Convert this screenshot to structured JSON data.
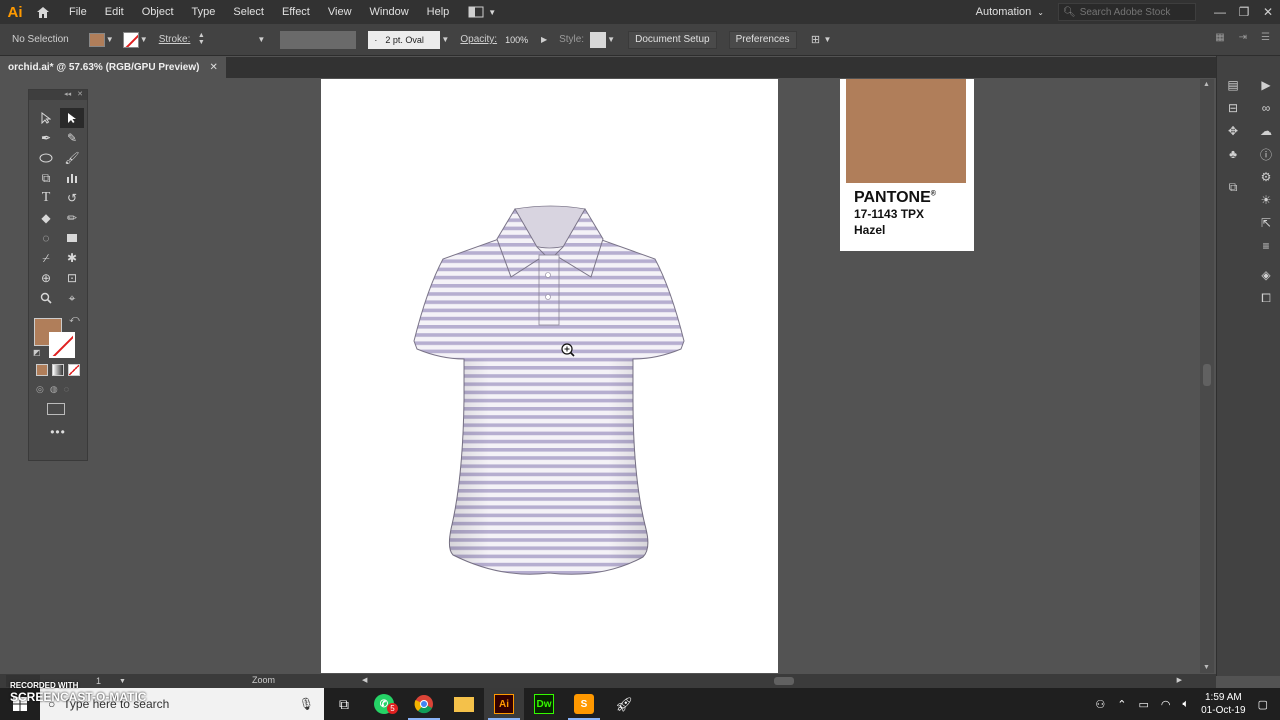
{
  "app": {
    "logo": "Ai"
  },
  "menu": [
    "File",
    "Edit",
    "Object",
    "Type",
    "Select",
    "Effect",
    "View",
    "Window",
    "Help"
  ],
  "workspace": {
    "label": "Automation"
  },
  "stock_search": {
    "placeholder": "Search Adobe Stock"
  },
  "control_bar": {
    "selection": "No Selection",
    "fill_color": "#b07e5a",
    "stroke_label": "Stroke:",
    "brush": "2 pt. Oval",
    "opacity_label": "Opacity:",
    "opacity_value": "100%",
    "style_label": "Style:",
    "document_setup": "Document Setup",
    "preferences": "Preferences"
  },
  "document_tab": {
    "title": "orchid.ai* @ 57.63% (RGB/GPU Preview)",
    "close": "✕"
  },
  "pantone": {
    "color": "#b07e5a",
    "brand": "PANTONE",
    "mark": "®",
    "code": "17-1143 TPX",
    "name": "Hazel"
  },
  "status_bar": {
    "page": "1",
    "tool": "Zoom"
  },
  "taskbar": {
    "search_placeholder": "Type here to search",
    "chrome_badge": "5",
    "apps": [
      "task-view",
      "whatsapp",
      "chrome",
      "file-explorer",
      "illustrator",
      "dreamweaver",
      "sublime",
      "rocket"
    ],
    "time": "1:59 AM",
    "date": "01-Oct-19"
  },
  "watermark": {
    "line1": "RECORDED WITH",
    "line2": "SCREENCAST-O-MATIC"
  }
}
